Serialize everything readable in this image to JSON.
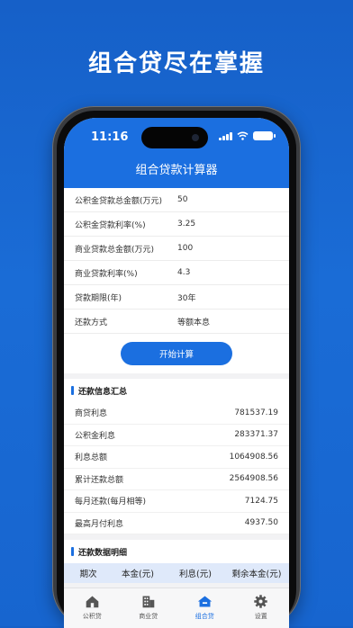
{
  "headline": "组合贷尽在掌握",
  "status": {
    "time": "11:16"
  },
  "app": {
    "title": "组合贷款计算器"
  },
  "form": {
    "rows": [
      {
        "label": "公积金贷款总金额(万元)",
        "value": "50"
      },
      {
        "label": "公积金贷款利率(%)",
        "value": "3.25"
      },
      {
        "label": "商业贷款总金额(万元)",
        "value": "100"
      },
      {
        "label": "商业贷款利率(%)",
        "value": "4.3"
      },
      {
        "label": "贷款期限(年)",
        "value": "30年"
      },
      {
        "label": "还款方式",
        "value": "等额本息"
      }
    ],
    "start_label": "开始计算"
  },
  "summary": {
    "title": "还款信息汇总",
    "rows": [
      {
        "label": "商贷利息",
        "value": "781537.19"
      },
      {
        "label": "公积金利息",
        "value": "283371.37"
      },
      {
        "label": "利息总额",
        "value": "1064908.56"
      },
      {
        "label": "累计还款总额",
        "value": "2564908.56"
      },
      {
        "label": "每月还款(每月相等)",
        "value": "7124.75"
      },
      {
        "label": "最高月付利息",
        "value": "4937.50"
      }
    ]
  },
  "detail": {
    "title": "还款数据明细",
    "columns": [
      "期次",
      "本金(元)",
      "利息(元)",
      "剩余本金(元)"
    ]
  },
  "tabs": [
    {
      "label": "公积贷",
      "icon": "house-icon"
    },
    {
      "label": "商业贷",
      "icon": "building-icon"
    },
    {
      "label": "组合贷",
      "icon": "combo-house-icon"
    },
    {
      "label": "设置",
      "icon": "gear-icon"
    }
  ],
  "colors": {
    "brand": "#1b6fe0",
    "background": "#1765cf",
    "header_row": "#dfe9fa"
  }
}
